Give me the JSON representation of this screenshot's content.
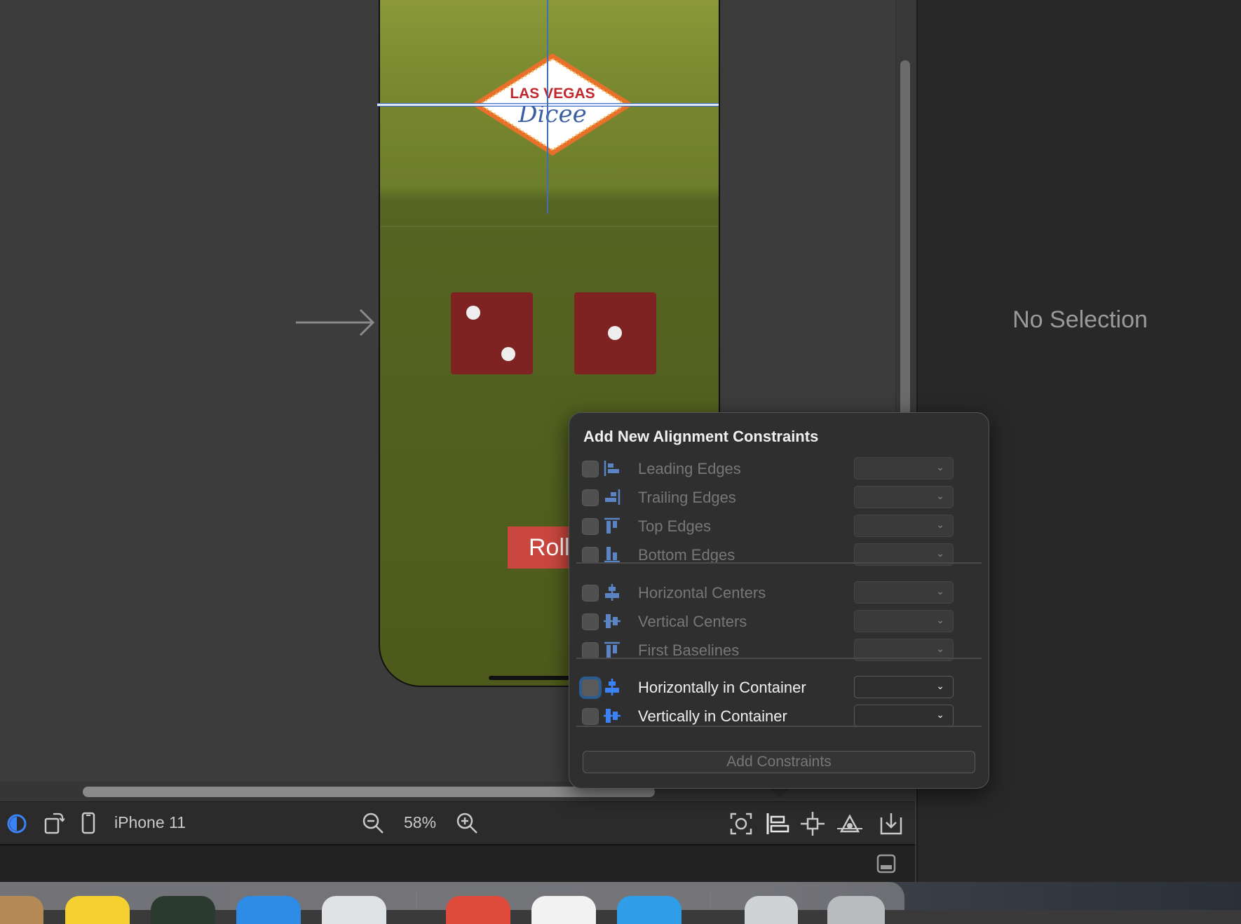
{
  "canvas": {
    "device_name": "iPhone 11",
    "zoom": "58%"
  },
  "app_preview": {
    "logo_line1": "LAS VEGAS",
    "logo_line2": "Dicee",
    "roll_button": "Roll",
    "die_left_value": 2,
    "die_right_value": 1
  },
  "inspector": {
    "empty_text": "No Selection"
  },
  "popover": {
    "title": "Add New Alignment Constraints",
    "edge_rows": [
      {
        "label": "Leading Edges",
        "icon": "leading-edges-icon",
        "checked": false
      },
      {
        "label": "Trailing Edges",
        "icon": "trailing-edges-icon",
        "checked": false
      },
      {
        "label": "Top Edges",
        "icon": "top-edges-icon",
        "checked": false
      },
      {
        "label": "Bottom Edges",
        "icon": "bottom-edges-icon",
        "checked": false
      }
    ],
    "center_rows": [
      {
        "label": "Horizontal Centers",
        "icon": "horizontal-centers-icon",
        "checked": false
      },
      {
        "label": "Vertical Centers",
        "icon": "vertical-centers-icon",
        "checked": false
      },
      {
        "label": "First Baselines",
        "icon": "first-baselines-icon",
        "checked": false
      }
    ],
    "container_rows": [
      {
        "label": "Horizontally in Container",
        "icon": "horizontally-in-container-icon",
        "checked": false
      },
      {
        "label": "Vertically in Container",
        "icon": "vertically-in-container-icon",
        "checked": false
      }
    ],
    "add_button": "Add Constraints"
  },
  "colors": {
    "accent": "#3b82f6",
    "die": "#7f2322",
    "roll_button": "#c9473e",
    "felt": "#6e7d2a"
  }
}
